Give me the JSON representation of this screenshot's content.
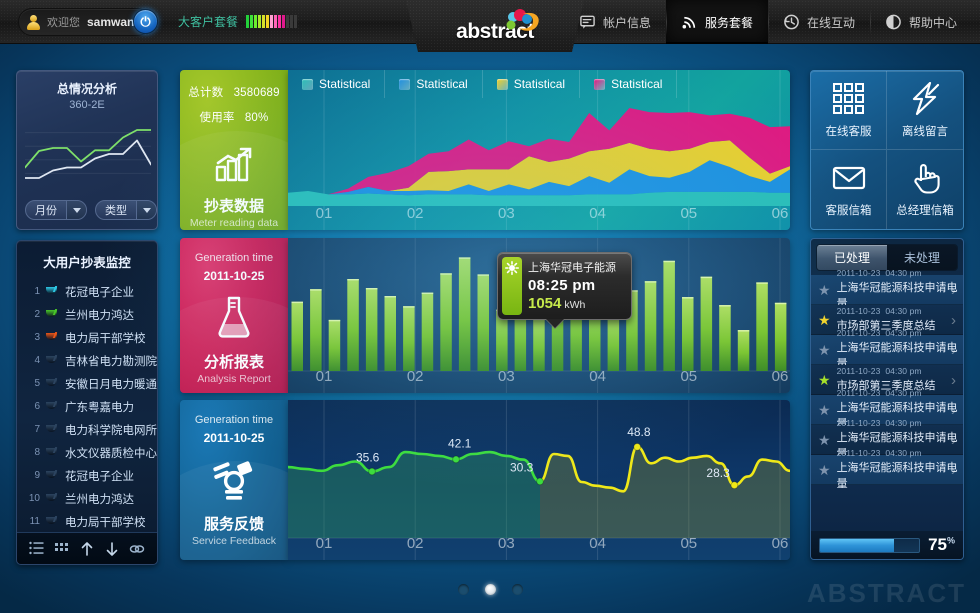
{
  "topbar": {
    "welcome": "欢迎您",
    "username": "samwang",
    "power_icon": "power-icon",
    "plan_label": "大客户套餐",
    "plan_bars": [
      "#23d13a",
      "#3ee23a",
      "#6bee2e",
      "#a8e92b",
      "#d6e02a",
      "#f2d522",
      "#ff9ed1",
      "#ff63b8",
      "#ff2fa3",
      "#e0198d",
      "#3a3a3a",
      "#3a3a3a",
      "#3a3a3a"
    ],
    "logo_text": "abstract",
    "nav": [
      {
        "label": "帐户信息",
        "icon": "account-card-icon",
        "active": false
      },
      {
        "label": "服务套餐",
        "icon": "rss-signal-icon",
        "active": true
      },
      {
        "label": "在线互动",
        "icon": "clock-back-icon",
        "active": false
      },
      {
        "label": "帮助中心",
        "icon": "info-circle-icon",
        "active": false
      }
    ]
  },
  "summary_panel": {
    "title": "总情况分析",
    "subtitle": "360-2E",
    "month_select": "月份",
    "type_select": "类型",
    "chart_data": {
      "type": "line",
      "title": "总情况分析",
      "series": [
        {
          "name": "green",
          "color": "#7ee06a",
          "values": [
            22,
            44,
            48,
            48,
            30,
            45,
            45,
            62,
            72,
            72
          ]
        },
        {
          "name": "white",
          "color": "#dfe7f2",
          "values": [
            8,
            8,
            18,
            22,
            22,
            34,
            40,
            40,
            58,
            26
          ]
        }
      ],
      "ylim": [
        0,
        80
      ],
      "grid": true
    }
  },
  "user_list": {
    "title": "大用户抄表监控",
    "items": [
      {
        "rank": "1",
        "name": "花冠电子企业",
        "medal": "#2ec8e6"
      },
      {
        "rank": "2",
        "name": "兰州电力鸿达",
        "medal": "#49c62a"
      },
      {
        "rank": "3",
        "name": "电力局干部学校",
        "medal": "#e8561a"
      },
      {
        "rank": "4",
        "name": "吉林省电力勘测院",
        "medal": "#2c4460"
      },
      {
        "rank": "5",
        "name": "安徽日月电力暖通",
        "medal": "#2c4460"
      },
      {
        "rank": "6",
        "name": "广东粤嘉电力",
        "medal": "#2c4460"
      },
      {
        "rank": "7",
        "name": "电力科学院电网所",
        "medal": "#2c4460"
      },
      {
        "rank": "8",
        "name": "水文仪器质检中心",
        "medal": "#2c4460"
      },
      {
        "rank": "9",
        "name": "花冠电子企业",
        "medal": "#2c4460"
      },
      {
        "rank": "10",
        "name": "兰州电力鸿达",
        "medal": "#2c4460"
      },
      {
        "rank": "11",
        "name": "电力局干部学校",
        "medal": "#2c4460"
      }
    ],
    "tools": [
      "list-view-icon",
      "grid-view-icon",
      "arrow-up-icon",
      "arrow-down-icon",
      "link-chain-icon"
    ]
  },
  "meter_kpi": {
    "total_label": "总计数",
    "total_value": "3580689",
    "rate_label": "使用率",
    "rate_value": "80%",
    "icon": "bar-chart-growth-icon",
    "title_cn": "抄表数据",
    "title_en": "Meter reading data"
  },
  "analysis_kpi": {
    "gen_label": "Generation time",
    "gen_date": "2011-10-25",
    "icon": "flask-icon",
    "title_cn": "分析报表",
    "title_en": "Analysis Report"
  },
  "feedback_kpi": {
    "gen_label": "Generation time",
    "gen_date": "2011-10-25",
    "icon": "service-feedback-icon",
    "title_cn": "服务反馈",
    "title_en": "Service Feedback"
  },
  "area_chart": {
    "legend": [
      {
        "label": "Statistical",
        "color": "#2bbfb8"
      },
      {
        "label": "Statistical",
        "color": "#1f8fe0"
      },
      {
        "label": "Statistical",
        "color": "#f2cf28"
      },
      {
        "label": "Statistical",
        "color": "#e6157f"
      }
    ],
    "chart_data": {
      "type": "area",
      "stacked": true,
      "title": "",
      "xlabel": "",
      "ylabel": "",
      "x_ticks": [
        "01",
        "02",
        "03",
        "04",
        "05",
        "06"
      ],
      "x": [
        0,
        1,
        2,
        3,
        4,
        5,
        6,
        7,
        8,
        9,
        10,
        11,
        12,
        13,
        14,
        15,
        16,
        17,
        18,
        19,
        20,
        21,
        22,
        23,
        24,
        25
      ],
      "series": [
        {
          "name": "Statistical",
          "color": "#2bbfb8",
          "values": [
            16,
            18,
            14,
            14,
            15,
            14,
            13,
            14,
            14,
            14,
            13,
            13,
            13,
            13,
            13,
            14,
            14,
            14,
            16,
            17,
            17,
            17,
            17,
            17,
            16,
            16
          ]
        },
        {
          "name": "Statistical",
          "color": "#1f8fe0",
          "values": [
            0,
            0,
            0,
            3,
            8,
            4,
            5,
            5,
            4,
            12,
            5,
            13,
            7,
            16,
            11,
            22,
            14,
            30,
            20,
            17,
            24,
            38,
            30,
            19,
            13,
            28
          ]
        },
        {
          "name": "Statistical",
          "color": "#f2cf28",
          "values": [
            0,
            0,
            0,
            0,
            0,
            0,
            4,
            22,
            24,
            18,
            26,
            18,
            40,
            24,
            33,
            30,
            41,
            32,
            33,
            32,
            28,
            22,
            32,
            22,
            10,
            4
          ]
        },
        {
          "name": "Statistical",
          "color": "#e6157f",
          "values": [
            0,
            0,
            0,
            4,
            12,
            22,
            26,
            22,
            24,
            36,
            23,
            34,
            12,
            28,
            20,
            46,
            22,
            42,
            44,
            46,
            44,
            32,
            32,
            48,
            56,
            48
          ]
        }
      ],
      "ylim": [
        0,
        130
      ],
      "grid": true
    }
  },
  "bar_chart": {
    "tooltip": {
      "title": "上海华冠电子能源",
      "time": "08:25 pm",
      "value": "1054",
      "unit": "kWh",
      "icon": "sun-icon"
    },
    "chart_data": {
      "type": "bar",
      "title": "",
      "x_ticks": [
        "01",
        "02",
        "03",
        "04",
        "05",
        "06"
      ],
      "categories": [
        "1",
        "2",
        "3",
        "4",
        "5",
        "6",
        "7",
        "8",
        "9",
        "10",
        "11",
        "12",
        "13",
        "14",
        "15",
        "16",
        "17",
        "18",
        "19",
        "20",
        "21",
        "22",
        "23",
        "24",
        "25",
        "26",
        "27"
      ],
      "values": [
        61,
        72,
        45,
        81,
        73,
        66,
        57,
        69,
        86,
        100,
        85,
        54,
        61,
        1054,
        88,
        70,
        63,
        50,
        71,
        79,
        97,
        65,
        83,
        58,
        36,
        78,
        60
      ],
      "bar_color": "#7fc92a",
      "ylabel": "kWh",
      "grid": true
    }
  },
  "line_chart": {
    "chart_data": {
      "type": "line",
      "title": "",
      "x_ticks": [
        "01",
        "02",
        "03",
        "04",
        "05",
        "06"
      ],
      "labels": [
        {
          "value": "35.6",
          "series": "green"
        },
        {
          "value": "42.1",
          "series": "green"
        },
        {
          "value": "30.3",
          "series": "green"
        },
        {
          "value": "48.8",
          "series": "yellow"
        },
        {
          "value": "28.3",
          "series": "yellow"
        }
      ],
      "series": [
        {
          "name": "green",
          "color": "#3ddc3d",
          "values": [
            38,
            37,
            36,
            39,
            41,
            35.6,
            38,
            46,
            45,
            44,
            42.1,
            45,
            46,
            44,
            42,
            30.3
          ]
        },
        {
          "name": "yellow",
          "color": "#f0e818",
          "values": [
            30.3,
            45,
            44,
            30,
            28,
            27,
            25,
            48.8,
            40,
            43,
            41,
            43,
            44,
            40,
            28.3,
            33,
            42,
            41,
            36
          ]
        }
      ],
      "ylim": [
        0,
        60
      ],
      "grid": true
    }
  },
  "quick_tiles": [
    {
      "label": "在线客服",
      "icon": "grid-nine-icon"
    },
    {
      "label": "离线留言",
      "icon": "lightning-bolt-icon"
    },
    {
      "label": "客服信箱",
      "icon": "envelope-icon"
    },
    {
      "label": "总经理信箱",
      "icon": "hand-pointer-icon"
    }
  ],
  "messages": {
    "tabs": [
      {
        "label": "已处理",
        "active": true
      },
      {
        "label": "未处理",
        "active": false
      }
    ],
    "items": [
      {
        "date": "2011-10-23",
        "time": "04:30 pm",
        "title": "上海华冠能源科技申请电量",
        "star": "#7e93ad"
      },
      {
        "date": "2011-10-23",
        "time": "04:30 pm",
        "title": "市场部第三季度总结",
        "star": "#f4d52a"
      },
      {
        "date": "2011-10-23",
        "time": "04:30 pm",
        "title": "上海华冠能源科技申请电量",
        "star": "#7e93ad"
      },
      {
        "date": "2011-10-23",
        "time": "04:30 pm",
        "title": "市场部第三季度总结",
        "star": "#a7e02a"
      },
      {
        "date": "2011-10-23",
        "time": "04:30 pm",
        "title": "上海华冠能源科技申请电量",
        "star": "#7e93ad"
      },
      {
        "date": "2011-10-23",
        "time": "04:30 pm",
        "title": "上海华冠能源科技申请电量",
        "star": "#7e93ad"
      },
      {
        "date": "2011-10-23",
        "time": "04:30 pm",
        "title": "上海华冠能源科技申请电量",
        "star": "#7e93ad"
      }
    ],
    "progress_value": 75,
    "progress_text": "75",
    "progress_unit": "%"
  },
  "pagination": {
    "count": 3,
    "active_index": 1
  },
  "watermark": "ABSTRACT"
}
